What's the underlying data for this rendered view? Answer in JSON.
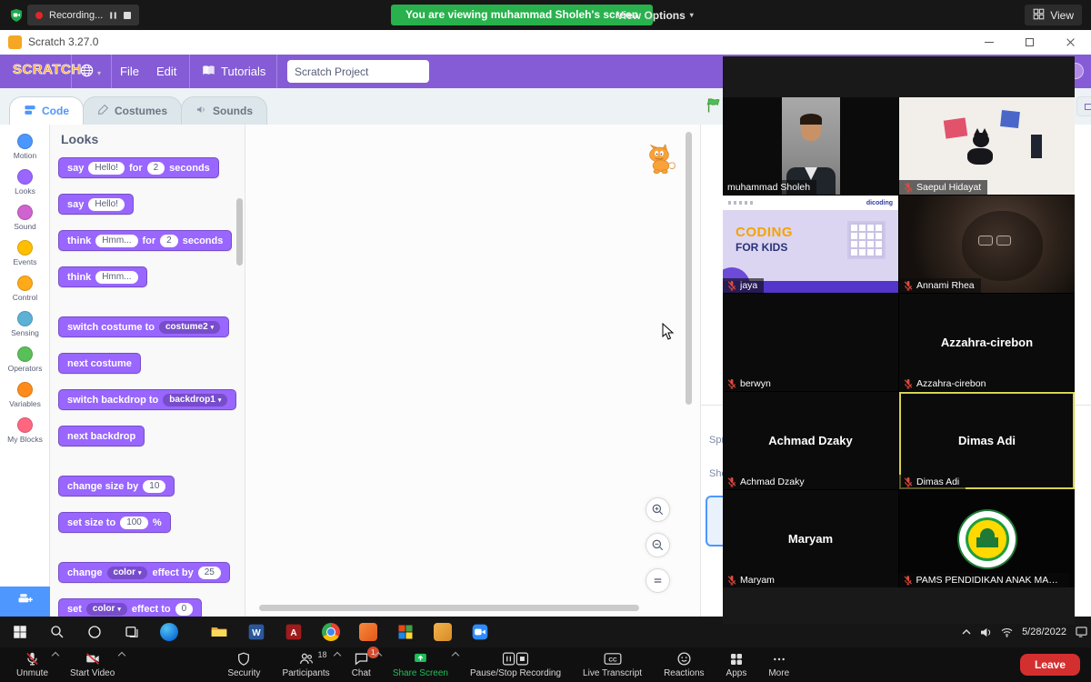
{
  "colors": {
    "banner_green": "#28B14C",
    "scratch_menubar_purple": "#855CD6",
    "looks_block_purple": "#9966FF",
    "active_speaker_border": "#D6D44F",
    "share_green": "#23BE5A",
    "leave_red": "#D42F2F",
    "scratch_blue": "#4D97FF"
  },
  "zoom_top": {
    "recording": "Recording...",
    "banner": "You are viewing muhammad Sholeh's screen",
    "view_options": "View Options",
    "view": "View"
  },
  "titlebar": {
    "title": "Scratch 3.27.0"
  },
  "menu": {
    "logo": "SCRATCH",
    "file": "File",
    "edit": "Edit",
    "tutorials": "Tutorials",
    "project_name": "Scratch Project"
  },
  "tabs": [
    {
      "label": "Code",
      "active": true
    },
    {
      "label": "Costumes",
      "active": false
    },
    {
      "label": "Sounds",
      "active": false
    }
  ],
  "categories": [
    {
      "label": "Motion",
      "color": "#4C97FF"
    },
    {
      "label": "Looks",
      "color": "#9966FF"
    },
    {
      "label": "Sound",
      "color": "#CF63CF"
    },
    {
      "label": "Events",
      "color": "#FFBF00"
    },
    {
      "label": "Control",
      "color": "#FFAB19"
    },
    {
      "label": "Sensing",
      "color": "#5CB1D6"
    },
    {
      "label": "Operators",
      "color": "#59C059"
    },
    {
      "label": "Variables",
      "color": "#FF8C1A"
    },
    {
      "label": "My Blocks",
      "color": "#FF6680"
    }
  ],
  "palette": {
    "header": "Looks",
    "blocks": [
      {
        "gap": 0,
        "parts": [
          {
            "t": "label",
            "v": "say"
          },
          {
            "t": "input",
            "v": "Hello!"
          },
          {
            "t": "label",
            "v": "for"
          },
          {
            "t": "input",
            "v": "2"
          },
          {
            "t": "label",
            "v": "seconds"
          }
        ]
      },
      {
        "gap": 0,
        "parts": [
          {
            "t": "label",
            "v": "say"
          },
          {
            "t": "input",
            "v": "Hello!"
          }
        ]
      },
      {
        "gap": 0,
        "parts": [
          {
            "t": "label",
            "v": "think"
          },
          {
            "t": "input",
            "v": "Hmm..."
          },
          {
            "t": "label",
            "v": "for"
          },
          {
            "t": "input",
            "v": "2"
          },
          {
            "t": "label",
            "v": "seconds"
          }
        ]
      },
      {
        "gap": 0,
        "parts": [
          {
            "t": "label",
            "v": "think"
          },
          {
            "t": "input",
            "v": "Hmm..."
          }
        ]
      },
      {
        "gap": 1,
        "parts": [
          {
            "t": "label",
            "v": "switch costume to"
          },
          {
            "t": "dropdown",
            "v": "costume2"
          }
        ]
      },
      {
        "gap": 0,
        "parts": [
          {
            "t": "label",
            "v": "next costume"
          }
        ]
      },
      {
        "gap": 0,
        "parts": [
          {
            "t": "label",
            "v": "switch backdrop to"
          },
          {
            "t": "dropdown",
            "v": "backdrop1"
          }
        ]
      },
      {
        "gap": 0,
        "parts": [
          {
            "t": "label",
            "v": "next backdrop"
          }
        ]
      },
      {
        "gap": 1,
        "parts": [
          {
            "t": "label",
            "v": "change size by"
          },
          {
            "t": "input",
            "v": "10"
          }
        ]
      },
      {
        "gap": 0,
        "parts": [
          {
            "t": "label",
            "v": "set size to"
          },
          {
            "t": "input",
            "v": "100"
          },
          {
            "t": "label",
            "v": "%"
          }
        ]
      },
      {
        "gap": 1,
        "parts": [
          {
            "t": "label",
            "v": "change"
          },
          {
            "t": "dropdown",
            "v": "color"
          },
          {
            "t": "label",
            "v": "effect by"
          },
          {
            "t": "input",
            "v": "25"
          }
        ]
      },
      {
        "gap": 0,
        "parts": [
          {
            "t": "label",
            "v": "set"
          },
          {
            "t": "dropdown",
            "v": "color"
          },
          {
            "t": "label",
            "v": "effect to"
          },
          {
            "t": "input",
            "v": "0"
          }
        ]
      }
    ]
  },
  "stage_panel": {
    "sprite_label": "Sprite",
    "show_label": "Show"
  },
  "meeting": {
    "participants": [
      {
        "name": "muhammad Sholeh",
        "tile": "photo-man",
        "muted": false,
        "active": false
      },
      {
        "name": "Saepul Hidayat",
        "tile": "art",
        "muted": true,
        "active": false
      },
      {
        "name": "jaya",
        "tile": "slide",
        "muted": true,
        "active": false
      },
      {
        "name": "Annami Rhea",
        "tile": "photo-dark",
        "muted": true,
        "active": false
      },
      {
        "name": "berwyn",
        "tile": "black",
        "muted": true,
        "active": false
      },
      {
        "name": "Azzahra-cirebon",
        "tile": "name",
        "muted": true,
        "active": false
      },
      {
        "name": "Achmad Dzaky",
        "tile": "name",
        "muted": true,
        "active": false
      },
      {
        "name": "Dimas Adi",
        "tile": "name",
        "muted": true,
        "active": true
      },
      {
        "name": "Maryam",
        "tile": "name",
        "muted": true,
        "active": false
      },
      {
        "name": "PAMS PENDIDIKAN ANAK MASJI...",
        "tile": "logo",
        "muted": true,
        "active": false
      }
    ],
    "slide": {
      "line1": "CODING",
      "line2": "FOR KIDS",
      "brand": "dicoding"
    }
  },
  "taskbar": {
    "date": "5/28/2022",
    "icons": [
      "windows-start",
      "search",
      "cortana",
      "task-view",
      "app-blue",
      "file-explorer",
      "word",
      "acrobat",
      "chrome",
      "app-orange",
      "app-grid",
      "app-amber",
      "zoom-client"
    ]
  },
  "zoom_controls": {
    "buttons": [
      {
        "label": "Unmute",
        "icon": "mic-off",
        "caret": true
      },
      {
        "label": "Start Video",
        "icon": "camera-off",
        "caret": true
      },
      {
        "label": "Security",
        "icon": "shield",
        "caret": false
      },
      {
        "label": "Participants",
        "icon": "participants",
        "caret": true,
        "count": "18"
      },
      {
        "label": "Chat",
        "icon": "chat",
        "caret": true,
        "badge": "1"
      },
      {
        "label": "Share Screen",
        "icon": "share-screen",
        "caret": true,
        "green": true
      },
      {
        "label": "Pause/Stop Recording",
        "icon": "recording",
        "caret": false
      },
      {
        "label": "Live Transcript",
        "icon": "cc",
        "caret": false
      },
      {
        "label": "Reactions",
        "icon": "reactions",
        "caret": false
      },
      {
        "label": "Apps",
        "icon": "apps",
        "caret": false
      },
      {
        "label": "More",
        "icon": "more",
        "caret": false
      }
    ],
    "leave": "Leave"
  }
}
